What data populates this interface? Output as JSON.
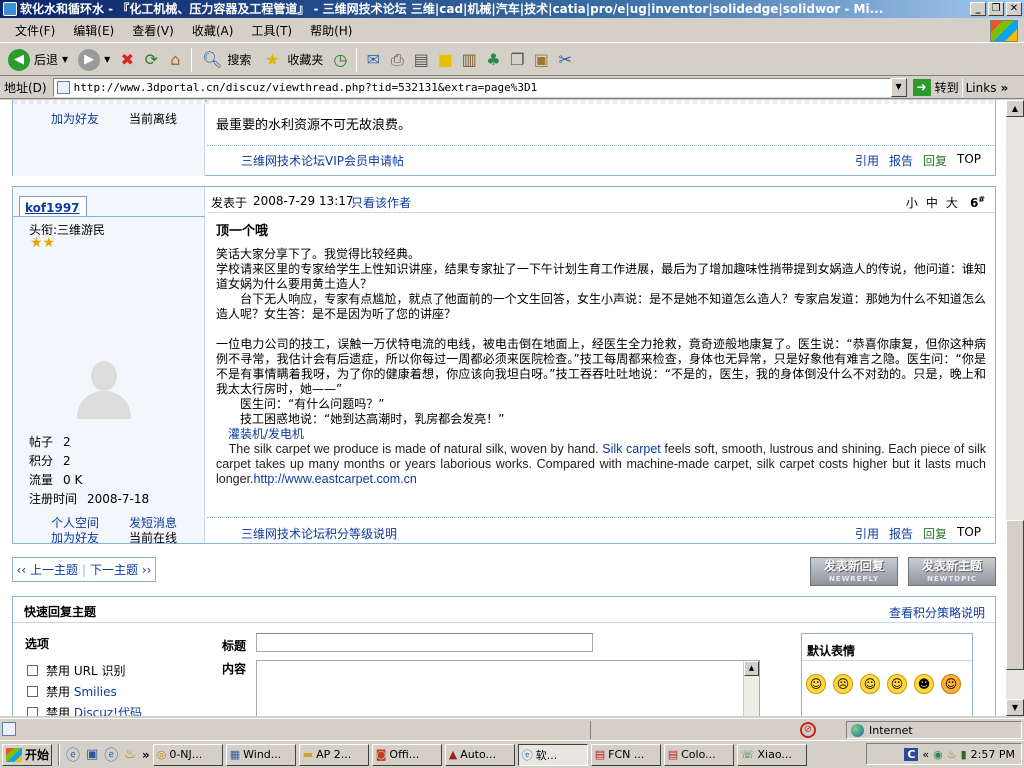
{
  "window": {
    "title": "软化水和循环水 - 『化工机械、压力容器及工程管道』 - 三维网技术论坛 三维|cad|机械|汽车|技术|catia|pro/e|ug|inventor|solidedge|solidwor - Mi..."
  },
  "menu": [
    "文件(F)",
    "编辑(E)",
    "查看(V)",
    "收藏(A)",
    "工具(T)",
    "帮助(H)"
  ],
  "toolbar": {
    "back": "后退",
    "search": "搜索",
    "favorites": "收藏夹"
  },
  "address": {
    "label": "地址(D)",
    "url": "http://www.3dportal.cn/discuz/viewthread.php?tid=532131&extra=page%3D1",
    "go": "转到",
    "links": "Links"
  },
  "prev_post": {
    "sidebar_add_friend": "加为好友",
    "sidebar_status": "当前离线",
    "partial_text": "最重要的水利资源不可无故浪费。",
    "footer_link": "三维网技术论坛VIP会员申请帖",
    "actions": [
      "引用",
      "报告",
      "回复",
      "TOP"
    ]
  },
  "post": {
    "author": "kof1997",
    "rank": "头衔:三维游民",
    "stats": [
      {
        "label": "帖子",
        "value": "2"
      },
      {
        "label": "积分",
        "value": "2"
      },
      {
        "label": "流量",
        "value": "0 K"
      },
      {
        "label": "注册时间",
        "value": "2008-7-18"
      }
    ],
    "links": [
      "个人空间",
      "发短消息",
      "加为好友",
      "当前在线"
    ],
    "posted_prefix": "发表于",
    "posted_time": "2008-7-29 13:17",
    "only_author": "只看该作者",
    "font_sizes": [
      "小",
      "中",
      "大"
    ],
    "floor": "6",
    "floor_sup": "#",
    "title": "顶一个哦",
    "p1": "笑话大家分享下了。我觉得比较经典。",
    "p2": "学校请来区里的专家给学生上性知识讲座，结果专家扯了一下午计划生育工作进展，最后为了增加趣味性捎带提到女娲造人的传说，他问道：谁知道女娲为什么要用黄土造人？",
    "p3": "　　台下无人响应，专家有点尴尬，就点了他面前的一个文生回答，女生小声说：是不是她不知道怎么造人？专家启发道：那她为什么不知道怎么造人呢？女生答：是不是因为听了您的讲座？",
    "p4": "一位电力公司的技工，误触一万伏特电流的电线，被电击倒在地面上，经医生全力抢救，竟奇迹般地康复了。医生说：“恭喜你康复，但你这种病例不寻常，我估计会有后遗症，所以你每过一周都必须来医院检查。”技工每周都来检查，身体也无异常，只是好象他有难言之隐。医生问：“你是不是有事情瞒着我呀，为了你的健康着想，你应该向我坦白呀。”技工吞吞吐吐地说：“不是的，医生，我的身体倒没什么不对劲的。只是，晚上和我太太行房时，她——”",
    "p5": "　　医生问：“有什么问题吗？”",
    "p6": "　　技工困惑地说：“她到达高潮时，乳房都会发亮！”",
    "ad_link": "灌装机/发电机",
    "en_pre": "　The silk carpet we produce is made of natural silk, woven by hand.",
    "en_link1": "Silk carpet",
    "en_post": "feels soft, smooth, lustrous and shining. Each piece of silk carpet takes up many months or years laborious works. Compared with machine-made carpet, silk carpet costs higher but it lasts much longer.",
    "en_link2": "http://www.eastcarpet.com.cn",
    "footer_link": "三维网技术论坛积分等级说明",
    "actions": [
      "引用",
      "报告",
      "回复",
      "TOP"
    ]
  },
  "nav": {
    "prev": "‹‹ 上一主题",
    "next": "下一主题 ››",
    "sep": "|"
  },
  "buttons": {
    "reply": "发表新回复",
    "reply_en": "NEWREPLY",
    "topic": "发表新主题",
    "topic_en": "NEWTOPIC"
  },
  "quick_reply": {
    "title": "快速回复主题",
    "policy_link": "查看积分策略说明",
    "options_label": "选项",
    "options": [
      {
        "text": "禁用 ",
        "link": ""
      },
      {
        "text": "禁用 ",
        "link": "Smilies"
      },
      {
        "text": "禁用 ",
        "link": "Discuz!代码"
      }
    ],
    "options_first_suffix": "URL 识别",
    "subject_label": "标题",
    "content_label": "内容",
    "smilies_title": "默认表情"
  },
  "smilies": [
    "smile-icon",
    "sad-icon",
    "biggrin-icon",
    "wink-icon",
    "grin-icon",
    "tongue-icon"
  ],
  "status": {
    "zone": "Internet"
  },
  "taskbar": {
    "start": "开始",
    "tasks": [
      "0-NJ...",
      "Wind...",
      "AP 2...",
      "Offi...",
      "Auto...",
      "软...",
      "FCN ...",
      "Colo...",
      "Xiao..."
    ],
    "active_index": 5,
    "clock": "2:57 PM",
    "lang": "C"
  }
}
